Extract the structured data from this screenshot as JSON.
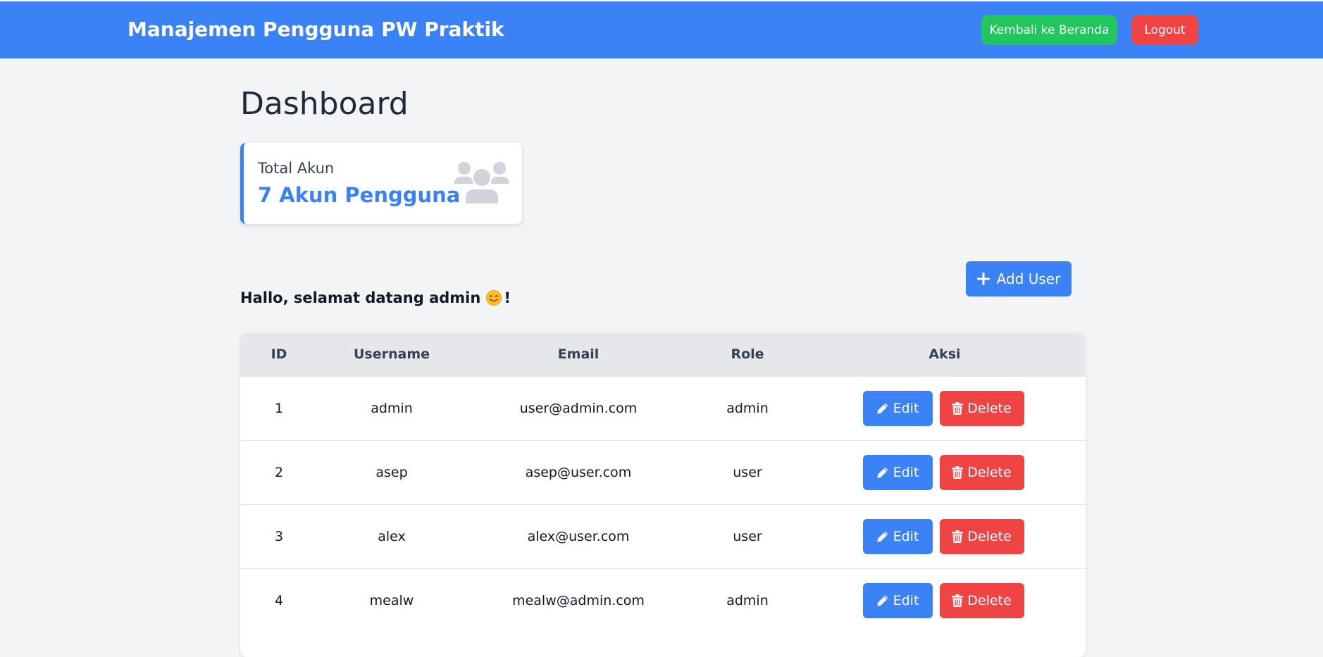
{
  "navbar": {
    "title": "Manajemen Pengguna PW Praktik",
    "home_button": "Kembali ke Beranda",
    "logout_button": "Logout"
  },
  "page": {
    "title": "Dashboard"
  },
  "stat_card": {
    "label": "Total Akun",
    "value": "7 Akun Pengguna",
    "icon": "users-icon"
  },
  "greeting": {
    "text": "Hallo, selamat datang admin",
    "suffix": "!"
  },
  "add_user_button": "Add User",
  "table": {
    "headers": [
      "ID",
      "Username",
      "Email",
      "Role",
      "Aksi"
    ],
    "edit_label": "Edit",
    "delete_label": "Delete",
    "rows": [
      {
        "id": "1",
        "username": "admin",
        "email": "user@admin.com",
        "role": "admin"
      },
      {
        "id": "2",
        "username": "asep",
        "email": "asep@user.com",
        "role": "user"
      },
      {
        "id": "3",
        "username": "alex",
        "email": "alex@user.com",
        "role": "user"
      },
      {
        "id": "4",
        "username": "mealw",
        "email": "mealw@admin.com",
        "role": "admin"
      }
    ]
  },
  "colors": {
    "primary": "#3b82f6",
    "success": "#22c55e",
    "danger": "#ef4444",
    "background": "#f3f4f6"
  }
}
